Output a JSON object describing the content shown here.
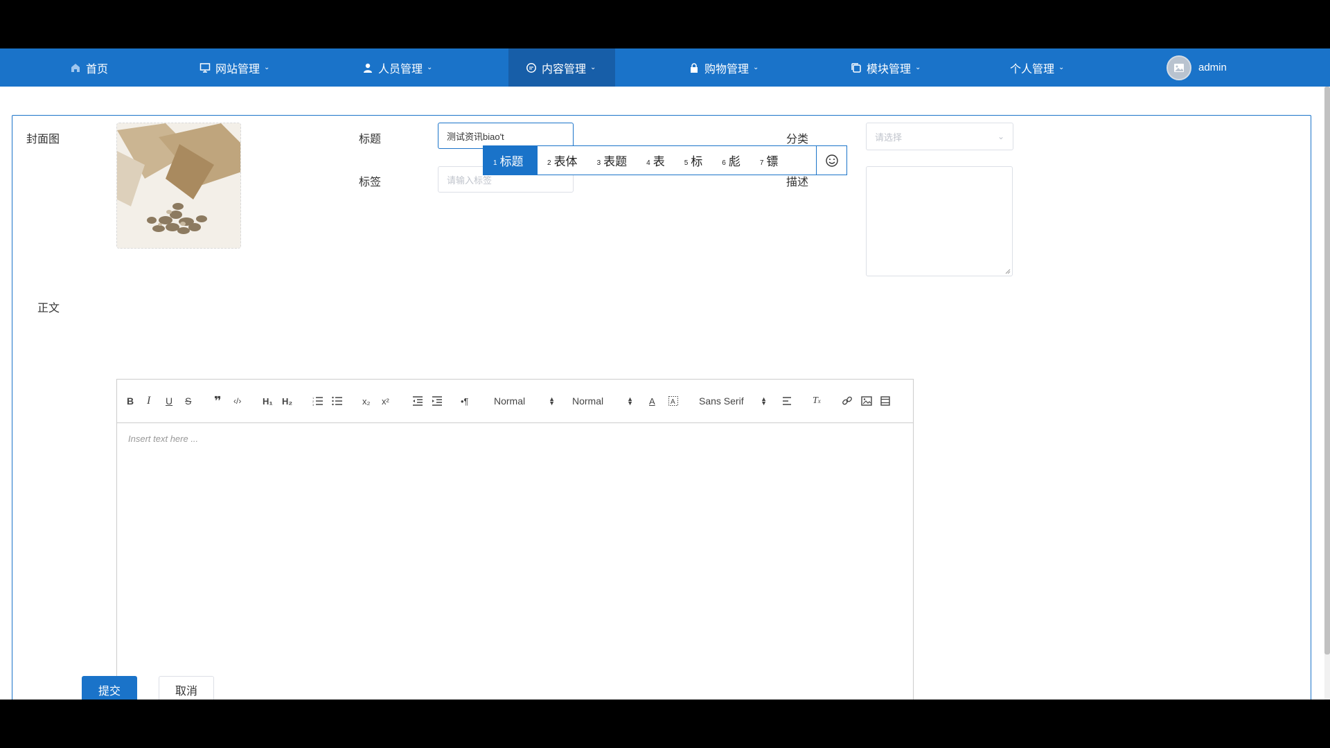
{
  "nav": {
    "items": [
      {
        "label": "首页",
        "icon": "home-icon"
      },
      {
        "label": "网站管理",
        "icon": "monitor-icon"
      },
      {
        "label": "人员管理",
        "icon": "user-icon"
      },
      {
        "label": "内容管理",
        "icon": "chat-icon"
      },
      {
        "label": "购物管理",
        "icon": "lock-icon"
      },
      {
        "label": "模块管理",
        "icon": "copy-icon"
      },
      {
        "label": "个人管理",
        "icon": ""
      }
    ],
    "active": "内容管理",
    "user": "admin"
  },
  "form": {
    "cover_label": "封面图",
    "title_label": "标题",
    "title_value": "测试资讯biao't",
    "tags_label": "标签",
    "tags_placeholder": "请输入标签",
    "category_label": "分类",
    "category_placeholder": "请选择",
    "desc_label": "描述",
    "body_label": "正文"
  },
  "ime": {
    "candidates": [
      {
        "n": "1",
        "text": "标题"
      },
      {
        "n": "2",
        "text": "表体"
      },
      {
        "n": "3",
        "text": "表题"
      },
      {
        "n": "4",
        "text": "表"
      },
      {
        "n": "5",
        "text": "标"
      },
      {
        "n": "6",
        "text": "彪"
      },
      {
        "n": "7",
        "text": "镖"
      }
    ],
    "selected_index": 0
  },
  "editor": {
    "toolbar": {
      "header_select": "Normal",
      "size_select": "Normal",
      "font_select": "Sans Serif"
    },
    "placeholder": "Insert text here ..."
  },
  "actions": {
    "submit": "提交",
    "cancel": "取消"
  },
  "colors": {
    "brand": "#1a73c9",
    "nav_active": "#175ea8"
  }
}
